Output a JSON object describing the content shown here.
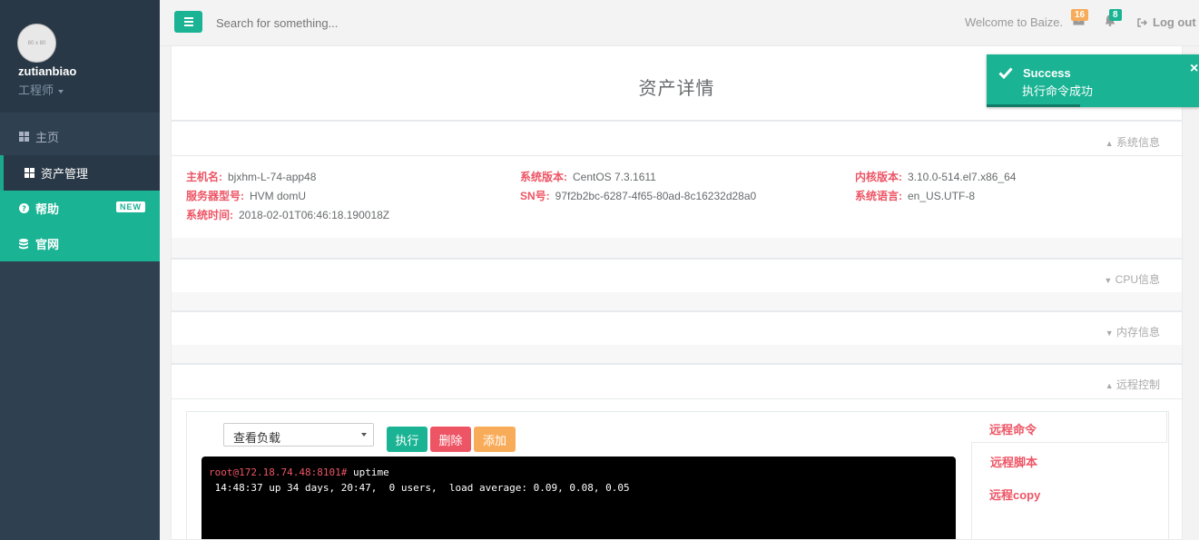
{
  "sidebar": {
    "avatar_text": "80 x 80",
    "user_name": "zutianbiao",
    "user_role": "工程师",
    "items": [
      {
        "label": "主页",
        "icon": "th-large-icon"
      },
      {
        "label": "资产管理",
        "icon": "th-large-icon"
      },
      {
        "label": "帮助",
        "icon": "question-circle-icon",
        "badge": "NEW"
      },
      {
        "label": "官网",
        "icon": "database-icon"
      }
    ]
  },
  "topbar": {
    "search_placeholder": "Search for something...",
    "welcome": "Welcome to Baize.",
    "mail_count": "16",
    "notif_count": "8",
    "logout": "Log out"
  },
  "page": {
    "title": "资产详情",
    "sections": {
      "system": "系统信息",
      "cpu": "CPU信息",
      "memory": "内存信息",
      "remote": "远程控制"
    },
    "system_info": {
      "hostname_label": "主机名:",
      "hostname": "bjxhm-L-74-app48",
      "os_label": "系统版本:",
      "os": "CentOS 7.3.1611",
      "kernel_label": "内核版本:",
      "kernel": "3.10.0-514.el7.x86_64",
      "model_label": "服务器型号:",
      "model": "HVM domU",
      "sn_label": "SN号:",
      "sn": "97f2b2bc-6287-4f65-80ad-8c16232d28a0",
      "lang_label": "系统语言:",
      "lang": "en_US.UTF-8",
      "time_label": "系统时间:",
      "time": "2018-02-01T06:46:18.190018Z"
    },
    "remote": {
      "selected_command": "查看负载",
      "execute_label": "执行",
      "delete_label": "删除",
      "add_label": "添加",
      "prompt": "root@172.18.74.48:8101#",
      "command": " uptime",
      "output": " 14:48:37 up 34 days, 20:47,  0 users,  load average: 0.09, 0.08, 0.05",
      "tabs": [
        "远程命令",
        "远程脚本",
        "远程copy"
      ]
    }
  },
  "toast": {
    "title": "Success",
    "message": "执行命令成功",
    "close": "×"
  },
  "colors": {
    "primary": "#1ab394",
    "danger": "#ed5565",
    "warning": "#f8ac59",
    "sidebar": "#2f4050"
  }
}
